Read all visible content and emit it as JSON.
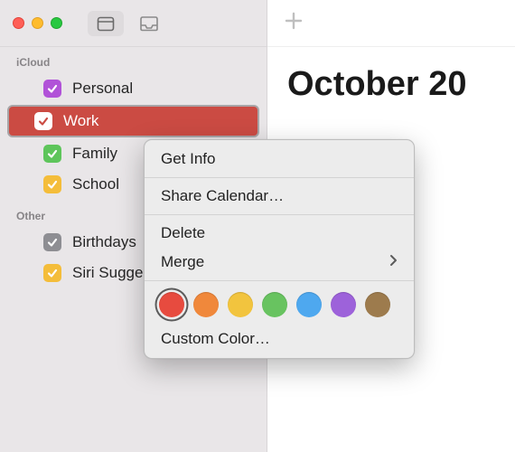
{
  "sidebar": {
    "sections": [
      {
        "title": "iCloud",
        "items": [
          {
            "label": "Personal",
            "color": "#b152d8",
            "selected": false
          },
          {
            "label": "Work",
            "color": "#ffffff",
            "bg": "#cb4b43",
            "selected": true
          },
          {
            "label": "Family",
            "color": "#5ec55b",
            "selected": false
          },
          {
            "label": "School",
            "color": "#f4bd3a",
            "selected": false
          }
        ]
      },
      {
        "title": "Other",
        "items": [
          {
            "label": "Birthdays",
            "color": "#8e8e93",
            "selected": false
          },
          {
            "label": "Siri Suggestions",
            "color": "#f4bd3a",
            "selected": false
          }
        ]
      }
    ]
  },
  "main": {
    "month_title": "October 20"
  },
  "context_menu": {
    "get_info": "Get Info",
    "share": "Share Calendar…",
    "delete": "Delete",
    "merge": "Merge",
    "custom_color": "Custom Color…",
    "colors": [
      {
        "hex": "#e74b3f",
        "selected": true
      },
      {
        "hex": "#f0883b",
        "selected": false
      },
      {
        "hex": "#f2c43e",
        "selected": false
      },
      {
        "hex": "#68c360",
        "selected": false
      },
      {
        "hex": "#4ea8ef",
        "selected": false
      },
      {
        "hex": "#9d62da",
        "selected": false
      },
      {
        "hex": "#9d7b4d",
        "selected": false
      }
    ]
  }
}
